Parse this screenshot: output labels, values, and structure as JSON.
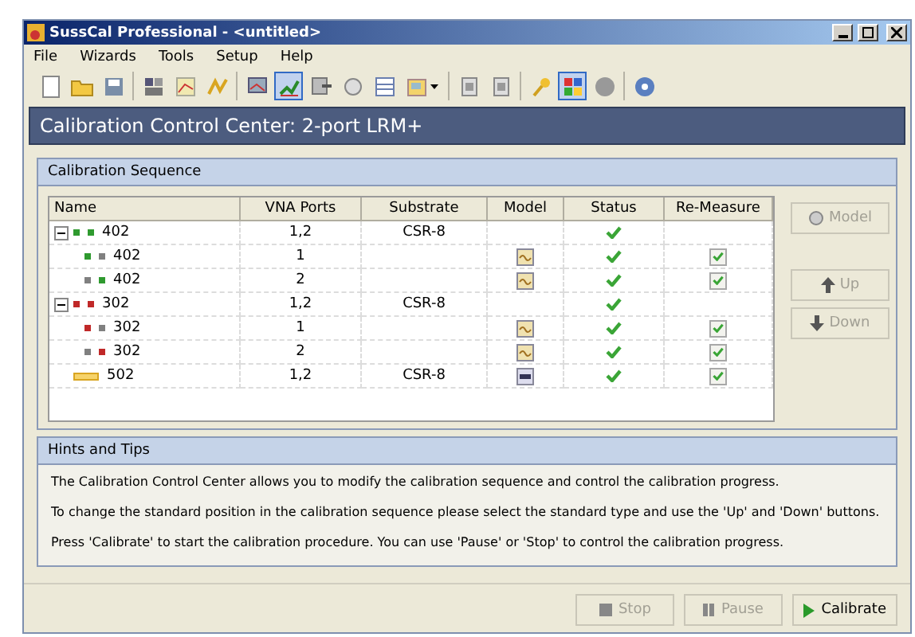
{
  "window": {
    "title": "SussCal Professional - <untitled>"
  },
  "menu": [
    {
      "label": "File"
    },
    {
      "label": "Wizards"
    },
    {
      "label": "Tools"
    },
    {
      "label": "Setup"
    },
    {
      "label": "Help"
    }
  ],
  "toolbar": [
    [
      {
        "kind": "new",
        "pressed": false
      },
      {
        "kind": "open",
        "pressed": false
      },
      {
        "kind": "save",
        "pressed": false
      }
    ],
    [
      {
        "kind": "grid",
        "pressed": false
      },
      {
        "kind": "chart",
        "pressed": false
      },
      {
        "kind": "spark",
        "pressed": false
      }
    ],
    [
      {
        "kind": "monitor",
        "pressed": false
      },
      {
        "kind": "graph",
        "pressed": true
      },
      {
        "kind": "export",
        "pressed": false
      },
      {
        "kind": "disc",
        "pressed": false
      },
      {
        "kind": "table",
        "pressed": false
      },
      {
        "kind": "report",
        "pressed": false,
        "dropdown": true
      }
    ],
    [
      {
        "kind": "doc",
        "pressed": false
      },
      {
        "kind": "doc",
        "pressed": false
      }
    ],
    [
      {
        "kind": "key",
        "pressed": false
      },
      {
        "kind": "blocks",
        "pressed": true
      },
      {
        "kind": "stop",
        "pressed": false
      }
    ],
    [
      {
        "kind": "help",
        "pressed": false
      }
    ]
  ],
  "header": "Calibration Control Center: 2-port LRM+",
  "sequence": {
    "title": "Calibration Sequence",
    "columns": [
      "Name",
      "VNA Ports",
      "Substrate",
      "Model",
      "Status",
      "Re-Measure"
    ],
    "rows": [
      {
        "kind": "pair",
        "name": "402",
        "markers": [
          {
            "color": "#2f9a2f"
          },
          {
            "color": "#2f9a2f"
          }
        ],
        "ports": "1,2",
        "substrate": "CSR-8",
        "status": true,
        "expanded": true,
        "children": [
          {
            "kind": "pair",
            "name": "402",
            "markers": [
              {
                "color": "#2f9a2f"
              },
              {
                "color": "#808080"
              }
            ],
            "ports": "1",
            "model": true,
            "status": true,
            "remeasure": true
          },
          {
            "kind": "pair",
            "name": "402",
            "markers": [
              {
                "color": "#808080"
              },
              {
                "color": "#2f9a2f"
              }
            ],
            "ports": "2",
            "model": true,
            "status": true,
            "remeasure": true
          }
        ]
      },
      {
        "kind": "pair",
        "name": "302",
        "markers": [
          {
            "color": "#c02828"
          },
          {
            "color": "#c02828"
          }
        ],
        "ports": "1,2",
        "substrate": "CSR-8",
        "status": true,
        "expanded": true,
        "children": [
          {
            "kind": "pair",
            "name": "302",
            "markers": [
              {
                "color": "#c02828"
              },
              {
                "color": "#808080"
              }
            ],
            "ports": "1",
            "model": true,
            "status": true,
            "remeasure": true
          },
          {
            "kind": "pair",
            "name": "302",
            "markers": [
              {
                "color": "#808080"
              },
              {
                "color": "#c02828"
              }
            ],
            "ports": "2",
            "model": true,
            "status": true,
            "remeasure": true
          }
        ]
      },
      {
        "kind": "thru",
        "name": "502",
        "ports": "1,2",
        "substrate": "CSR-8",
        "model": true,
        "status": true,
        "remeasure": true
      }
    ],
    "buttons": [
      {
        "kind": "model",
        "label": "Model",
        "disabled": true
      },
      {
        "kind": "up",
        "label": "Up",
        "disabled": true
      },
      {
        "kind": "down",
        "label": "Down",
        "disabled": true
      }
    ]
  },
  "hints": {
    "title": "Hints and Tips",
    "lines": [
      "The Calibration Control Center allows you to modify the calibration sequence and control the calibration progress.",
      "To change the standard position in the calibration sequence please select the standard type and use the 'Up' and 'Down' buttons.",
      "Press 'Calibrate' to start the calibration procedure.  You can use 'Pause' or 'Stop' to control the calibration progress."
    ]
  },
  "actions": [
    {
      "kind": "stop",
      "label": "Stop",
      "disabled": true
    },
    {
      "kind": "pause",
      "label": "Pause",
      "disabled": true
    },
    {
      "kind": "play",
      "label": "Calibrate",
      "disabled": false
    }
  ]
}
